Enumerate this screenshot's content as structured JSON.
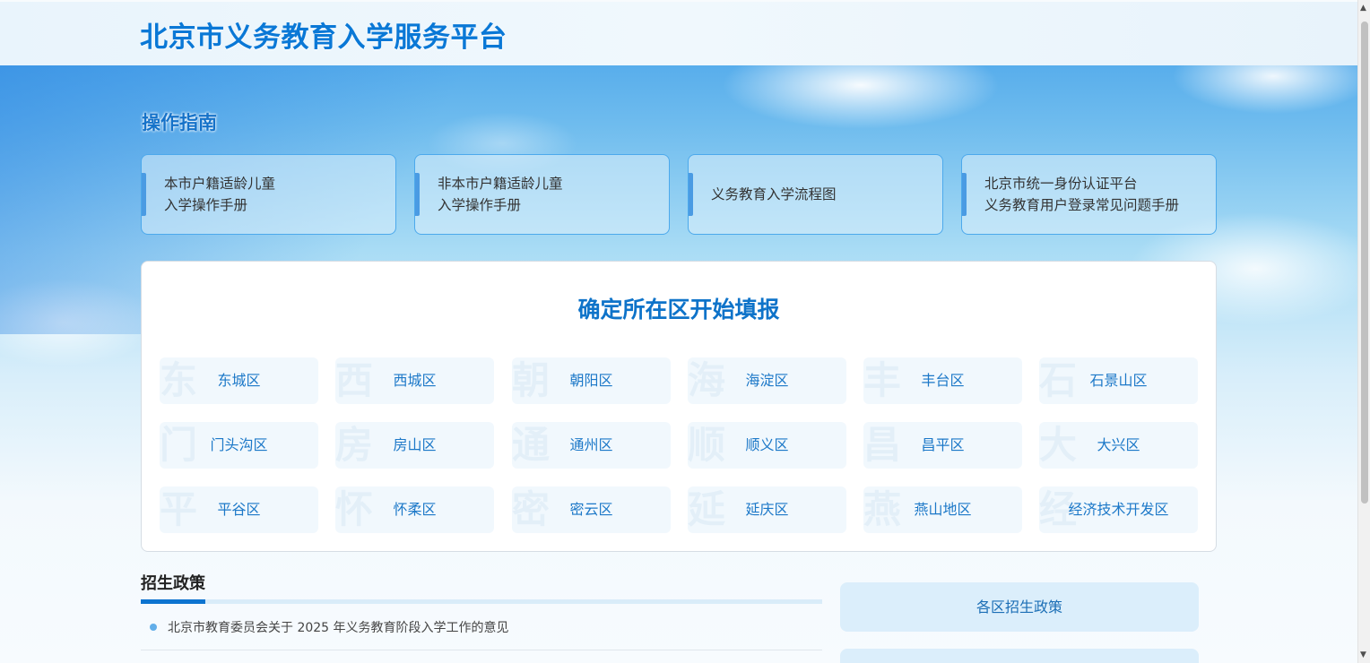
{
  "header": {
    "title": "北京市义务教育入学服务平台"
  },
  "guide": {
    "title": "操作指南",
    "cards": [
      {
        "line1": "本市户籍适龄儿童",
        "line2": "入学操作手册"
      },
      {
        "line1": "非本市户籍适龄儿童",
        "line2": "入学操作手册"
      },
      {
        "line1": "义务教育入学流程图",
        "line2": ""
      },
      {
        "line1": "北京市统一身份认证平台",
        "line2": "义务教育用户登录常见问题手册"
      }
    ]
  },
  "districts": {
    "title": "确定所在区开始填报",
    "items": [
      {
        "label": "东城区",
        "mark": "东"
      },
      {
        "label": "西城区",
        "mark": "西"
      },
      {
        "label": "朝阳区",
        "mark": "朝"
      },
      {
        "label": "海淀区",
        "mark": "海"
      },
      {
        "label": "丰台区",
        "mark": "丰"
      },
      {
        "label": "石景山区",
        "mark": "石"
      },
      {
        "label": "门头沟区",
        "mark": "门"
      },
      {
        "label": "房山区",
        "mark": "房"
      },
      {
        "label": "通州区",
        "mark": "通"
      },
      {
        "label": "顺义区",
        "mark": "顺"
      },
      {
        "label": "昌平区",
        "mark": "昌"
      },
      {
        "label": "大兴区",
        "mark": "大"
      },
      {
        "label": "平谷区",
        "mark": "平"
      },
      {
        "label": "怀柔区",
        "mark": "怀"
      },
      {
        "label": "密云区",
        "mark": "密"
      },
      {
        "label": "延庆区",
        "mark": "延"
      },
      {
        "label": "燕山地区",
        "mark": "燕"
      },
      {
        "label": "经济技术开发区",
        "mark": "经"
      }
    ]
  },
  "policy": {
    "title": "招生政策",
    "items": [
      {
        "text": "北京市教育委员会关于 2025 年义务教育阶段入学工作的意见"
      }
    ]
  },
  "sidebar": {
    "district_policy": "各区招生政策"
  },
  "colors": {
    "brand": "#0a78d6",
    "accent_border": "#4ca9ec"
  }
}
